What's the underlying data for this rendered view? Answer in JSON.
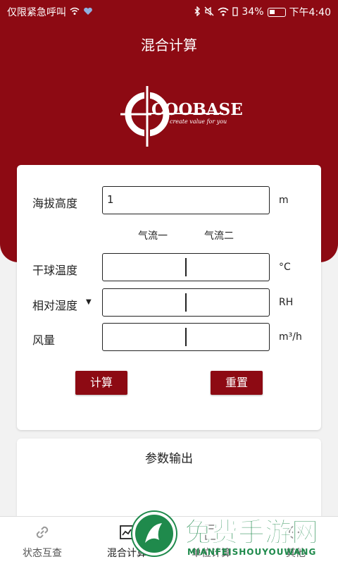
{
  "status_bar": {
    "carrier": "仅限紧急呼叫",
    "battery_pct": "34%",
    "time": "下午4:40"
  },
  "header": {
    "title": "混合计算"
  },
  "logo": {
    "name": "COOBASE",
    "tagline": "create value for you"
  },
  "form": {
    "altitude": {
      "label": "海拔高度",
      "value": "1",
      "unit": "m"
    },
    "flow_headers": {
      "flow1": "气流一",
      "flow2": "气流二"
    },
    "dry_bulb": {
      "label": "干球温度",
      "unit": "°C"
    },
    "humidity": {
      "label": "相对湿度",
      "unit": "RH",
      "arrow": "▼"
    },
    "airflow": {
      "label": "风量",
      "unit": "m³/h"
    }
  },
  "buttons": {
    "calculate": "计算",
    "reset": "重置"
  },
  "output": {
    "title": "参数输出"
  },
  "tabs": [
    {
      "label": "状态互查",
      "icon": "link-icon"
    },
    {
      "label": "混合计算",
      "icon": "chart-icon"
    },
    {
      "label": "单位计算",
      "icon": "calc-icon"
    },
    {
      "label": "其他",
      "icon": "more-icon"
    }
  ],
  "watermark": {
    "title": "免费手游网",
    "subtitle": "MIANFEISHOUYOUWANG"
  },
  "colors": {
    "brand": "#8d0a13",
    "watermark": "#1f8a4c"
  }
}
